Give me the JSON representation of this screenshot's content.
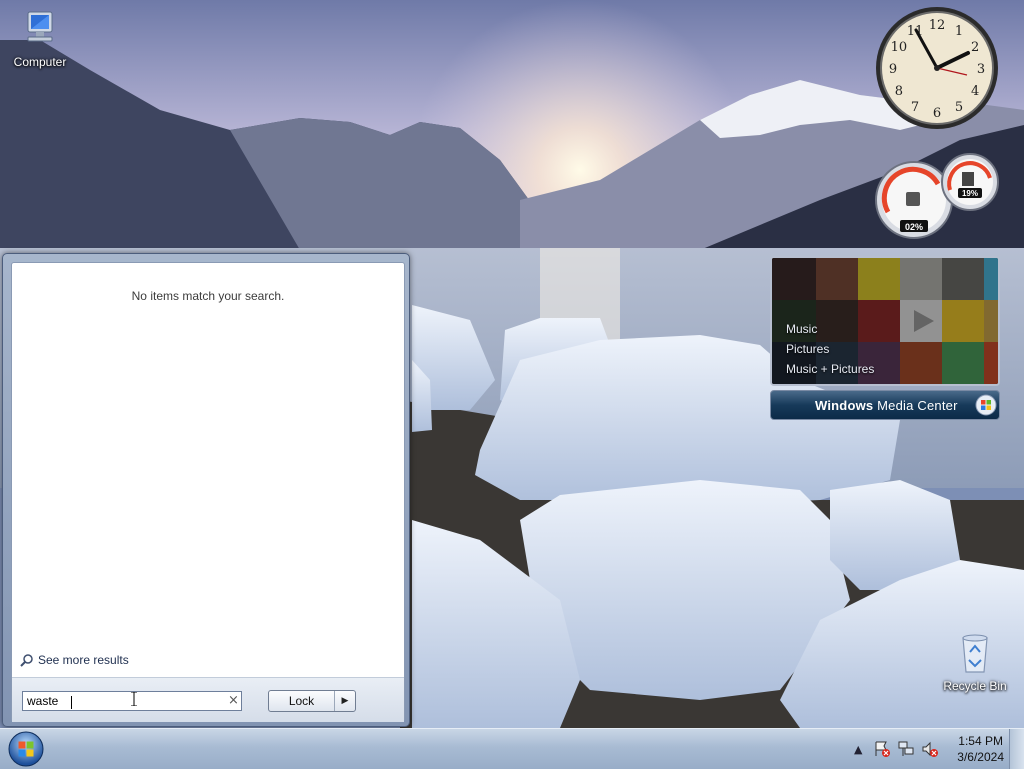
{
  "desktop": {
    "icons": [
      {
        "label": "Computer",
        "icon": "computer-icon"
      },
      {
        "label": "Recycle Bin",
        "icon": "recycle-bin-icon"
      }
    ]
  },
  "start_menu": {
    "no_results_text": "No items match your search.",
    "see_more_label": "See more results",
    "search": {
      "value": "waste",
      "placeholder": ""
    },
    "power_button_label": "Lock"
  },
  "gadgets": {
    "clock": {
      "time_shown": "1:54",
      "numerals": [
        "12",
        "1",
        "2",
        "3",
        "4",
        "5",
        "6",
        "7",
        "8",
        "9",
        "10",
        "11"
      ]
    },
    "cpu_meter": {
      "cpu_label": "02%",
      "cpu_percent": 2,
      "memory_label": "19%",
      "memory_percent": 19
    },
    "media_center": {
      "menu_items": [
        "Music",
        "Pictures",
        "Music + Pictures"
      ],
      "title_bold": "Windows",
      "title_light": " Media Center"
    }
  },
  "taskbar": {
    "time": "1:54 PM",
    "date": "3/6/2024",
    "tray_icons": [
      "show-hidden-icons",
      "action-center-icon",
      "network-icon",
      "volume-muted-icon"
    ]
  },
  "colors": {
    "taskbar": "#a8bbd3",
    "start_menu_frame": "#8294b2",
    "media_center_bar": "#173a5a"
  }
}
